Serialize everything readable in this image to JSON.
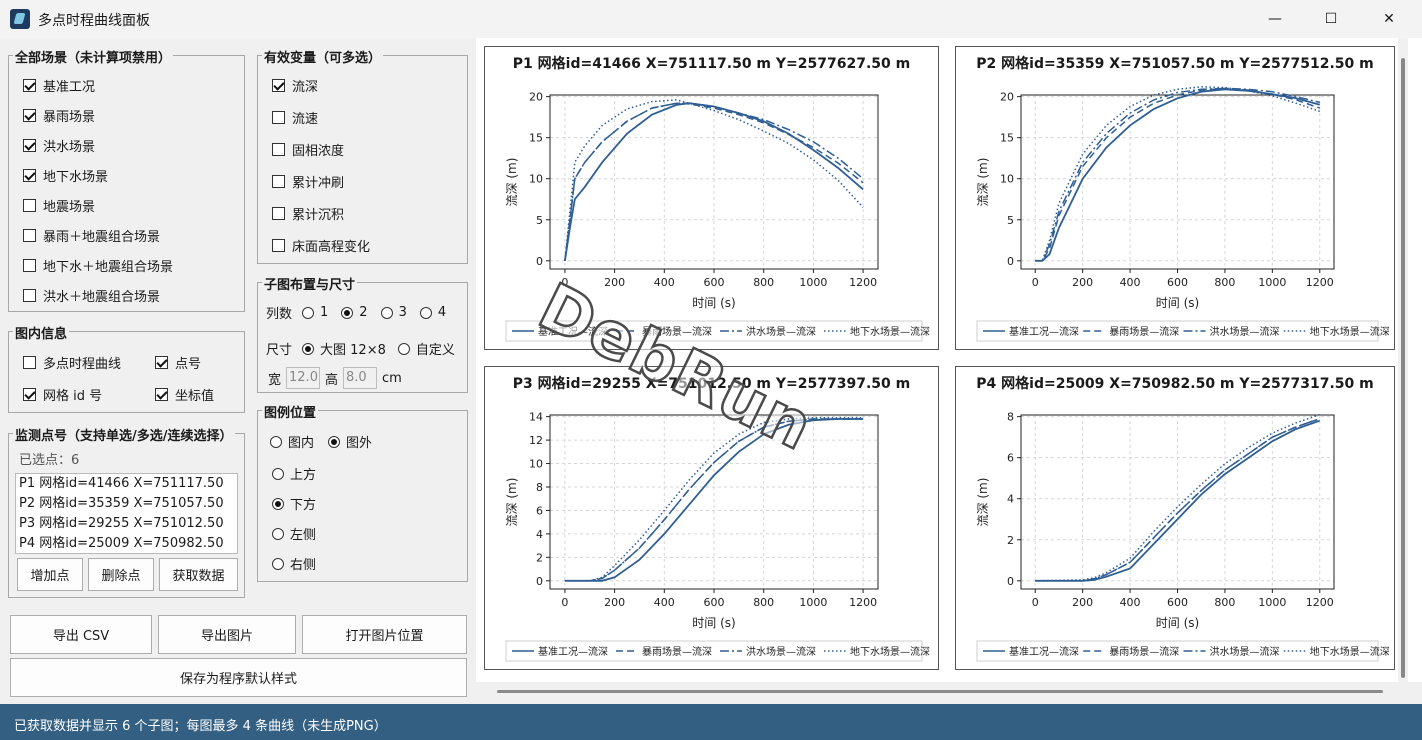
{
  "window": {
    "title": "多点时程曲线面板",
    "min": "—",
    "max": "☐",
    "close": "✕"
  },
  "scenarios": {
    "title": "全部场景（未计算项禁用）",
    "items": [
      {
        "label": "基准工况",
        "checked": true
      },
      {
        "label": "暴雨场景",
        "checked": true
      },
      {
        "label": "洪水场景",
        "checked": true
      },
      {
        "label": "地下水场景",
        "checked": true
      },
      {
        "label": "地震场景",
        "checked": false
      },
      {
        "label": "暴雨＋地震组合场景",
        "checked": false
      },
      {
        "label": "地下水＋地震组合场景",
        "checked": false
      },
      {
        "label": "洪水＋地震组合场景",
        "checked": false
      }
    ]
  },
  "variables": {
    "title": "有效变量（可多选）",
    "items": [
      {
        "label": "流深",
        "checked": true
      },
      {
        "label": "流速",
        "checked": false
      },
      {
        "label": "固相浓度",
        "checked": false
      },
      {
        "label": "累计冲刷",
        "checked": false
      },
      {
        "label": "累计沉积",
        "checked": false
      },
      {
        "label": "床面高程变化",
        "checked": false
      }
    ]
  },
  "layout": {
    "title": "子图布置与尺寸",
    "cols_label": "列数",
    "cols": [
      "1",
      "2",
      "3",
      "4"
    ],
    "size_label": "尺寸",
    "size_big": "大图 12×8",
    "size_custom": "自定义",
    "w_label": "宽",
    "w_val": "12.0",
    "h_label": "高",
    "h_val": "8.0",
    "unit": "cm"
  },
  "info": {
    "title": "图内信息",
    "multi": "多点时程曲线",
    "point_no": "点号",
    "grid_id": "网格 id 号",
    "coord": "坐标值"
  },
  "legend_pos": {
    "title": "图例位置",
    "inside": "图内",
    "outside": "图外",
    "top": "上方",
    "bottom": "下方",
    "left": "左侧",
    "right": "右侧"
  },
  "points": {
    "title": "监测点号（支持单选/多选/连续选择）",
    "count_text": "已选点：6",
    "rows": [
      "P1   网格id=41466    X=751117.50",
      "P2   网格id=35359    X=751057.50",
      "P3   网格id=29255    X=751012.50",
      "P4   网格id=25009    X=750982.50"
    ],
    "add": "增加点",
    "delete": "删除点",
    "fetch": "获取数据"
  },
  "actions": {
    "export_csv": "导出 CSV",
    "export_img": "导出图片",
    "open_loc": "打开图片位置",
    "save_default": "保存为程序默认样式"
  },
  "status": "已获取数据并显示 6 个子图；每图最多 4 条曲线（未生成PNG）",
  "watermark": "DebRun",
  "colors": {
    "line": "#2e5e94",
    "status": "#335f83"
  },
  "chart_data": [
    {
      "type": "line",
      "title": "P1  网格id=41466  X=751117.50 m  Y=2577627.50 m",
      "xlabel": "时间 (s)",
      "ylabel": "流深 (m)",
      "xlim": [
        0,
        1200
      ],
      "ylim": [
        0,
        20
      ],
      "xticks": [
        0,
        200,
        400,
        600,
        800,
        1000,
        1200
      ],
      "yticks": [
        0,
        5,
        10,
        15,
        20
      ],
      "x": [
        0,
        20,
        40,
        80,
        150,
        250,
        350,
        450,
        500,
        600,
        700,
        800,
        900,
        1000,
        1100,
        1200
      ],
      "series": [
        {
          "name": "基准工况—流深",
          "style": "solid",
          "values": [
            0,
            4,
            7.5,
            9,
            12,
            15.5,
            17.8,
            19,
            19.2,
            18.8,
            18,
            17,
            15.5,
            13.5,
            11.3,
            8.7
          ]
        },
        {
          "name": "暴雨场景—流深",
          "style": "dash",
          "values": [
            0,
            5,
            10,
            12,
            14.5,
            17,
            18.6,
            19.2,
            19.1,
            18.6,
            17.8,
            16.8,
            15.4,
            13.8,
            11.9,
            9.5
          ]
        },
        {
          "name": "洪水场景—流深",
          "style": "dashdot",
          "values": [
            0,
            5,
            10,
            12,
            14.5,
            17,
            18.6,
            19.2,
            19.2,
            18.8,
            18,
            17.2,
            16,
            14.5,
            12.5,
            10
          ]
        },
        {
          "name": "地下水场景—流深",
          "style": "dot",
          "values": [
            0,
            6,
            12,
            14,
            16.5,
            18.5,
            19.4,
            19.6,
            19.2,
            18.3,
            17.2,
            15.8,
            14.3,
            12.3,
            9.8,
            6.5
          ]
        }
      ],
      "legend": "bottom",
      "grid": true
    },
    {
      "type": "line",
      "title": "P2  网格id=35359  X=751057.50 m  Y=2577512.50 m",
      "xlabel": "时间 (s)",
      "ylabel": "流深 (m)",
      "xlim": [
        0,
        1200
      ],
      "ylim": [
        0,
        20
      ],
      "xticks": [
        0,
        200,
        400,
        600,
        800,
        1000,
        1200
      ],
      "yticks": [
        0,
        5,
        10,
        15,
        20
      ],
      "x": [
        0,
        30,
        60,
        100,
        200,
        300,
        400,
        500,
        600,
        700,
        800,
        900,
        1000,
        1100,
        1200
      ],
      "series": [
        {
          "name": "基准工况—流深",
          "style": "solid",
          "values": [
            0,
            0,
            0.8,
            4,
            10,
            13.8,
            16.5,
            18.5,
            19.8,
            20.6,
            20.9,
            20.7,
            20.3,
            19.8,
            19
          ]
        },
        {
          "name": "暴雨场景—流深",
          "style": "dash",
          "values": [
            0,
            0,
            1.5,
            5.5,
            11.5,
            15,
            17.5,
            19.2,
            20.2,
            20.8,
            21,
            20.8,
            20.3,
            19.6,
            18.6
          ]
        },
        {
          "name": "洪水场景—流深",
          "style": "dashdot",
          "values": [
            0,
            0,
            2,
            6,
            12,
            15.5,
            18,
            19.6,
            20.5,
            20.9,
            21,
            20.9,
            20.6,
            20,
            19.3
          ]
        },
        {
          "name": "地下水场景—流深",
          "style": "dot",
          "values": [
            0,
            0,
            2.5,
            7,
            13,
            16.5,
            18.8,
            20.2,
            20.9,
            21.2,
            21.1,
            20.7,
            20.1,
            19.2,
            18.2
          ]
        }
      ],
      "legend": "bottom",
      "grid": true
    },
    {
      "type": "line",
      "title": "P3  网格id=29255  X=751012.50 m  Y=2577397.50 m",
      "xlabel": "时间 (s)",
      "ylabel": "流深 (m)",
      "xlim": [
        0,
        1200
      ],
      "ylim": [
        0,
        14
      ],
      "xticks": [
        0,
        200,
        400,
        600,
        800,
        1000,
        1200
      ],
      "yticks": [
        0,
        2,
        4,
        6,
        8,
        10,
        12,
        14
      ],
      "x": [
        0,
        100,
        150,
        200,
        300,
        400,
        500,
        600,
        700,
        800,
        900,
        1000,
        1100,
        1200
      ],
      "series": [
        {
          "name": "基准工况—流深",
          "style": "solid",
          "values": [
            0,
            0,
            0,
            0.3,
            1.8,
            4,
            6.5,
            9,
            11,
            12.5,
            13.3,
            13.7,
            13.8,
            13.8
          ]
        },
        {
          "name": "暴雨场景—流深",
          "style": "dash",
          "values": [
            0,
            0,
            0.2,
            0.9,
            2.8,
            5.2,
            7.8,
            10.1,
            11.9,
            13.1,
            13.6,
            13.8,
            13.8,
            13.8
          ]
        },
        {
          "name": "洪水场景—流深",
          "style": "dashdot",
          "values": [
            0,
            0,
            0.2,
            0.9,
            2.8,
            5.2,
            7.8,
            10.1,
            11.9,
            13.1,
            13.6,
            13.8,
            13.8,
            13.8
          ]
        },
        {
          "name": "地下水场景—流深",
          "style": "dot",
          "values": [
            0,
            0,
            0.3,
            1.3,
            3.5,
            6,
            8.6,
            10.9,
            12.5,
            13.5,
            13.8,
            13.9,
            13.9,
            13.9
          ]
        }
      ],
      "legend": "bottom",
      "grid": true
    },
    {
      "type": "line",
      "title": "P4  网格id=25009  X=750982.50 m  Y=2577317.50 m",
      "xlabel": "时间 (s)",
      "ylabel": "流深 (m)",
      "xlim": [
        0,
        1200
      ],
      "ylim": [
        0,
        8
      ],
      "xticks": [
        0,
        200,
        400,
        600,
        800,
        1000,
        1200
      ],
      "yticks": [
        0,
        2,
        4,
        6,
        8
      ],
      "x": [
        0,
        200,
        250,
        300,
        400,
        500,
        600,
        700,
        800,
        900,
        1000,
        1100,
        1200
      ],
      "series": [
        {
          "name": "基准工况—流深",
          "style": "solid",
          "values": [
            0,
            0,
            0.05,
            0.2,
            0.6,
            1.8,
            3,
            4.2,
            5.2,
            6,
            6.8,
            7.4,
            7.8
          ]
        },
        {
          "name": "暴雨场景—流深",
          "style": "dash",
          "values": [
            0,
            0,
            0.1,
            0.3,
            0.9,
            2.1,
            3.3,
            4.4,
            5.4,
            6.2,
            7,
            7.5,
            7.9
          ]
        },
        {
          "name": "洪水场景—流深",
          "style": "dashdot",
          "values": [
            0,
            0,
            0.1,
            0.3,
            0.9,
            2.1,
            3.3,
            4.4,
            5.4,
            6.2,
            7,
            7.5,
            7.9
          ]
        },
        {
          "name": "地下水场景—流深",
          "style": "dot",
          "values": [
            0,
            0.05,
            0.15,
            0.4,
            1.1,
            2.4,
            3.6,
            4.7,
            5.7,
            6.5,
            7.2,
            7.7,
            8.1
          ]
        }
      ],
      "legend": "bottom",
      "grid": true
    }
  ]
}
